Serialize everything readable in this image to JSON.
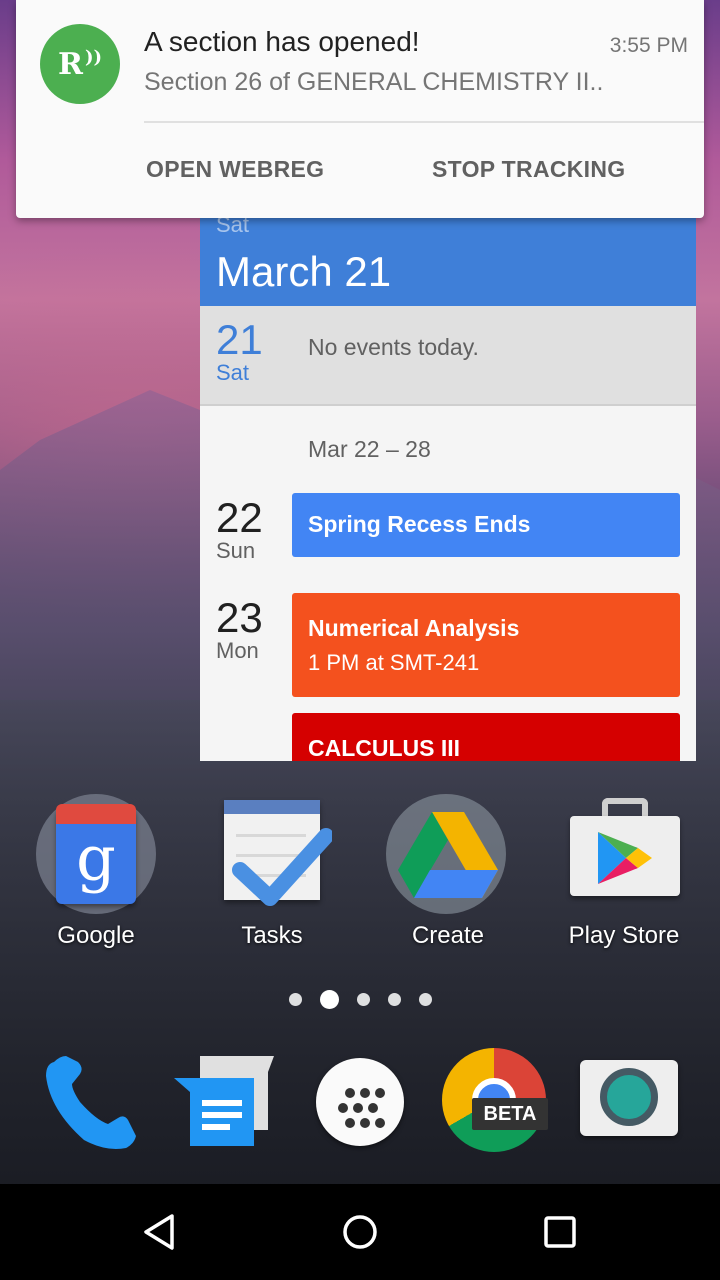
{
  "notification": {
    "app_icon": "rutgers-radio-icon",
    "icon_letter": "R",
    "title": "A section has opened!",
    "time": "3:55 PM",
    "text": "Section 26 of GENERAL CHEMISTRY II..",
    "actions": {
      "open": "OPEN WEBREG",
      "stop": "STOP TRACKING"
    },
    "accent_color": "#4caf50"
  },
  "calendar": {
    "header_day": "Sat",
    "header_date": "March 21",
    "today": {
      "day_num": "21",
      "day_name": "Sat",
      "message": "No events today."
    },
    "week_range": "Mar 22 – 28",
    "days": [
      {
        "day_num": "22",
        "day_name": "Sun"
      },
      {
        "day_num": "23",
        "day_name": "Mon"
      }
    ],
    "events": [
      {
        "title": "Spring Recess Ends",
        "subtitle": "",
        "color": "#4285f4"
      },
      {
        "title": "Numerical Analysis",
        "subtitle": "1 PM at SMT-241",
        "color": "#f4511e"
      },
      {
        "title": "CALCULUS III",
        "subtitle": "",
        "color": "#d50000"
      }
    ],
    "header_color": "#3f7fd8"
  },
  "apps": [
    {
      "label": "Google",
      "icon": "google-folder-icon"
    },
    {
      "label": "Tasks",
      "icon": "tasks-icon"
    },
    {
      "label": "Create",
      "icon": "drive-icon"
    },
    {
      "label": "Play Store",
      "icon": "play-store-icon"
    }
  ],
  "page_indicator": {
    "count": 5,
    "active_index": 1
  },
  "dock": [
    {
      "name": "phone",
      "icon": "phone-icon"
    },
    {
      "name": "messenger",
      "icon": "messenger-icon"
    },
    {
      "name": "app-drawer",
      "icon": "app-drawer-icon"
    },
    {
      "name": "chrome-beta",
      "icon": "chrome-beta-icon",
      "badge": "BETA"
    },
    {
      "name": "camera",
      "icon": "camera-icon"
    }
  ],
  "navbar": {
    "back": "back-icon",
    "home": "home-icon",
    "recents": "recents-icon"
  }
}
